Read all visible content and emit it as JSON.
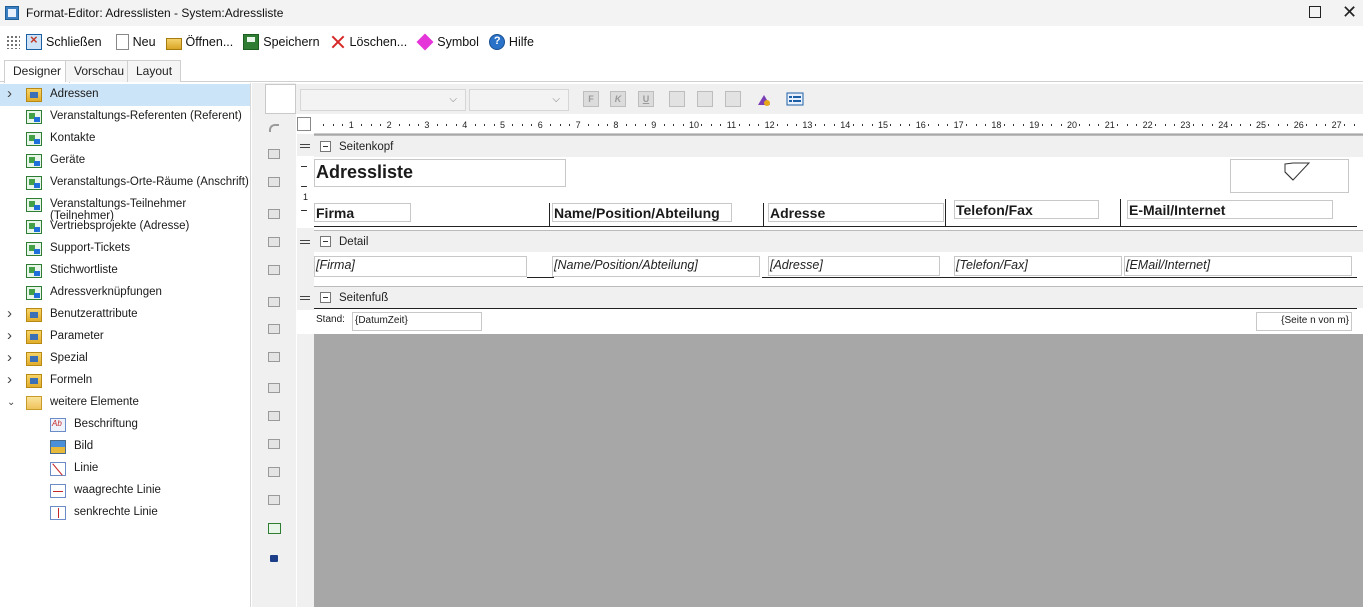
{
  "window": {
    "title": "Format-Editor: Adresslisten - System:Adressliste",
    "maximize_icon": "maximize-icon",
    "close_glyph": "✕"
  },
  "toolbar": {
    "items": [
      {
        "label": "Schließen",
        "icon": "close-window-icon"
      },
      {
        "label": "Neu",
        "icon": "new-document-icon"
      },
      {
        "label": "Öffnen...",
        "icon": "open-folder-icon"
      },
      {
        "label": "Speichern",
        "icon": "save-icon"
      },
      {
        "label": "Löschen...",
        "icon": "delete-icon"
      },
      {
        "label": "Symbol",
        "icon": "symbol-icon"
      },
      {
        "label": "Hilfe",
        "icon": "help-icon"
      }
    ]
  },
  "tabs": [
    {
      "label": "Designer",
      "active": true
    },
    {
      "label": "Vorschau",
      "active": false
    },
    {
      "label": "Layout",
      "active": false
    }
  ],
  "tree": {
    "items": [
      {
        "label": "Adressen",
        "level": 0,
        "expander": "›",
        "icon": "database-folder-icon",
        "selected": true
      },
      {
        "label": "Veranstaltungs-Referenten (Referent)",
        "level": 1,
        "icon": "relation-icon"
      },
      {
        "label": "Kontakte",
        "level": 1,
        "icon": "relation-icon"
      },
      {
        "label": "Geräte",
        "level": 1,
        "icon": "relation-icon"
      },
      {
        "label": "Veranstaltungs-Orte-Räume (Anschrift)",
        "level": 1,
        "icon": "relation-icon"
      },
      {
        "label": "Veranstaltungs-Teilnehmer (Teilnehmer)",
        "level": 1,
        "icon": "relation-icon"
      },
      {
        "label": "Vertriebsprojekte (Adresse)",
        "level": 1,
        "icon": "relation-icon"
      },
      {
        "label": "Support-Tickets",
        "level": 1,
        "icon": "relation-icon"
      },
      {
        "label": "Stichwortliste",
        "level": 1,
        "icon": "relation-icon"
      },
      {
        "label": "Adressverknüpfungen",
        "level": 1,
        "icon": "relation-icon"
      },
      {
        "label": "Benutzerattribute",
        "level": 0,
        "expander": "›",
        "icon": "database-folder-icon"
      },
      {
        "label": "Parameter",
        "level": 0,
        "expander": "›",
        "icon": "database-folder-icon"
      },
      {
        "label": "Spezial",
        "level": 0,
        "expander": "›",
        "icon": "database-folder-icon"
      },
      {
        "label": "Formeln",
        "level": 0,
        "expander": "›",
        "icon": "database-folder-icon"
      },
      {
        "label": "weitere Elemente",
        "level": 0,
        "expander": "⌄",
        "icon": "folder-icon"
      },
      {
        "label": "Beschriftung",
        "level": 2,
        "icon": "label-icon"
      },
      {
        "label": "Bild",
        "level": 2,
        "icon": "image-icon"
      },
      {
        "label": "Linie",
        "level": 2,
        "icon": "line-icon"
      },
      {
        "label": "waagrechte Linie",
        "level": 2,
        "icon": "horizontal-line-icon"
      },
      {
        "label": "senkrechte Linie",
        "level": 2,
        "icon": "vertical-line-icon"
      }
    ]
  },
  "vertical_tools": [
    "undo-icon",
    "bring-forward-icon",
    "send-backward-icon",
    "align-left-icon",
    "align-center-icon",
    "align-right-icon",
    "align-top-icon",
    "align-middle-icon",
    "align-bottom-icon",
    "same-size-icon",
    "same-height-icon",
    "space-horizontal-icon",
    "space-vertical-icon",
    "distribute-icon",
    "check-icon",
    "lock-icon"
  ],
  "format_toolbar": {
    "font_combo": "",
    "size_combo": "",
    "buttons": [
      "bold-icon",
      "italic-icon",
      "underline-icon",
      "align-left-text-icon",
      "align-center-text-icon",
      "align-right-text-icon",
      "paint-icon",
      "properties-icon"
    ],
    "bold_glyph": "F",
    "italic_glyph": "K",
    "underline_glyph": "U"
  },
  "ruler": {
    "labels": [
      "1",
      "2",
      "3",
      "4",
      "5",
      "6",
      "7",
      "8",
      "9",
      "10",
      "11",
      "12",
      "13",
      "14",
      "15",
      "16",
      "17",
      "18",
      "19",
      "20",
      "21",
      "22",
      "23",
      "24",
      "25",
      "26",
      "27"
    ]
  },
  "report": {
    "bands": {
      "header": "Seitenkopf",
      "detail": "Detail",
      "footer": "Seitenfuß"
    },
    "title": "Adressliste",
    "columns": [
      "Firma",
      "Name/Position/Abteilung",
      "Adresse",
      "Telefon/Fax",
      "E-Mail/Internet"
    ],
    "detail_fields": [
      "[Firma]",
      "[Name/Position/Abteilung]",
      "[Adresse]",
      "[Telefon/Fax]",
      "[EMail/Internet]"
    ],
    "footer": {
      "stand_label": "Stand:",
      "stand_value": "{DatumZeit}",
      "page_value": "{Seite n von m}"
    }
  }
}
